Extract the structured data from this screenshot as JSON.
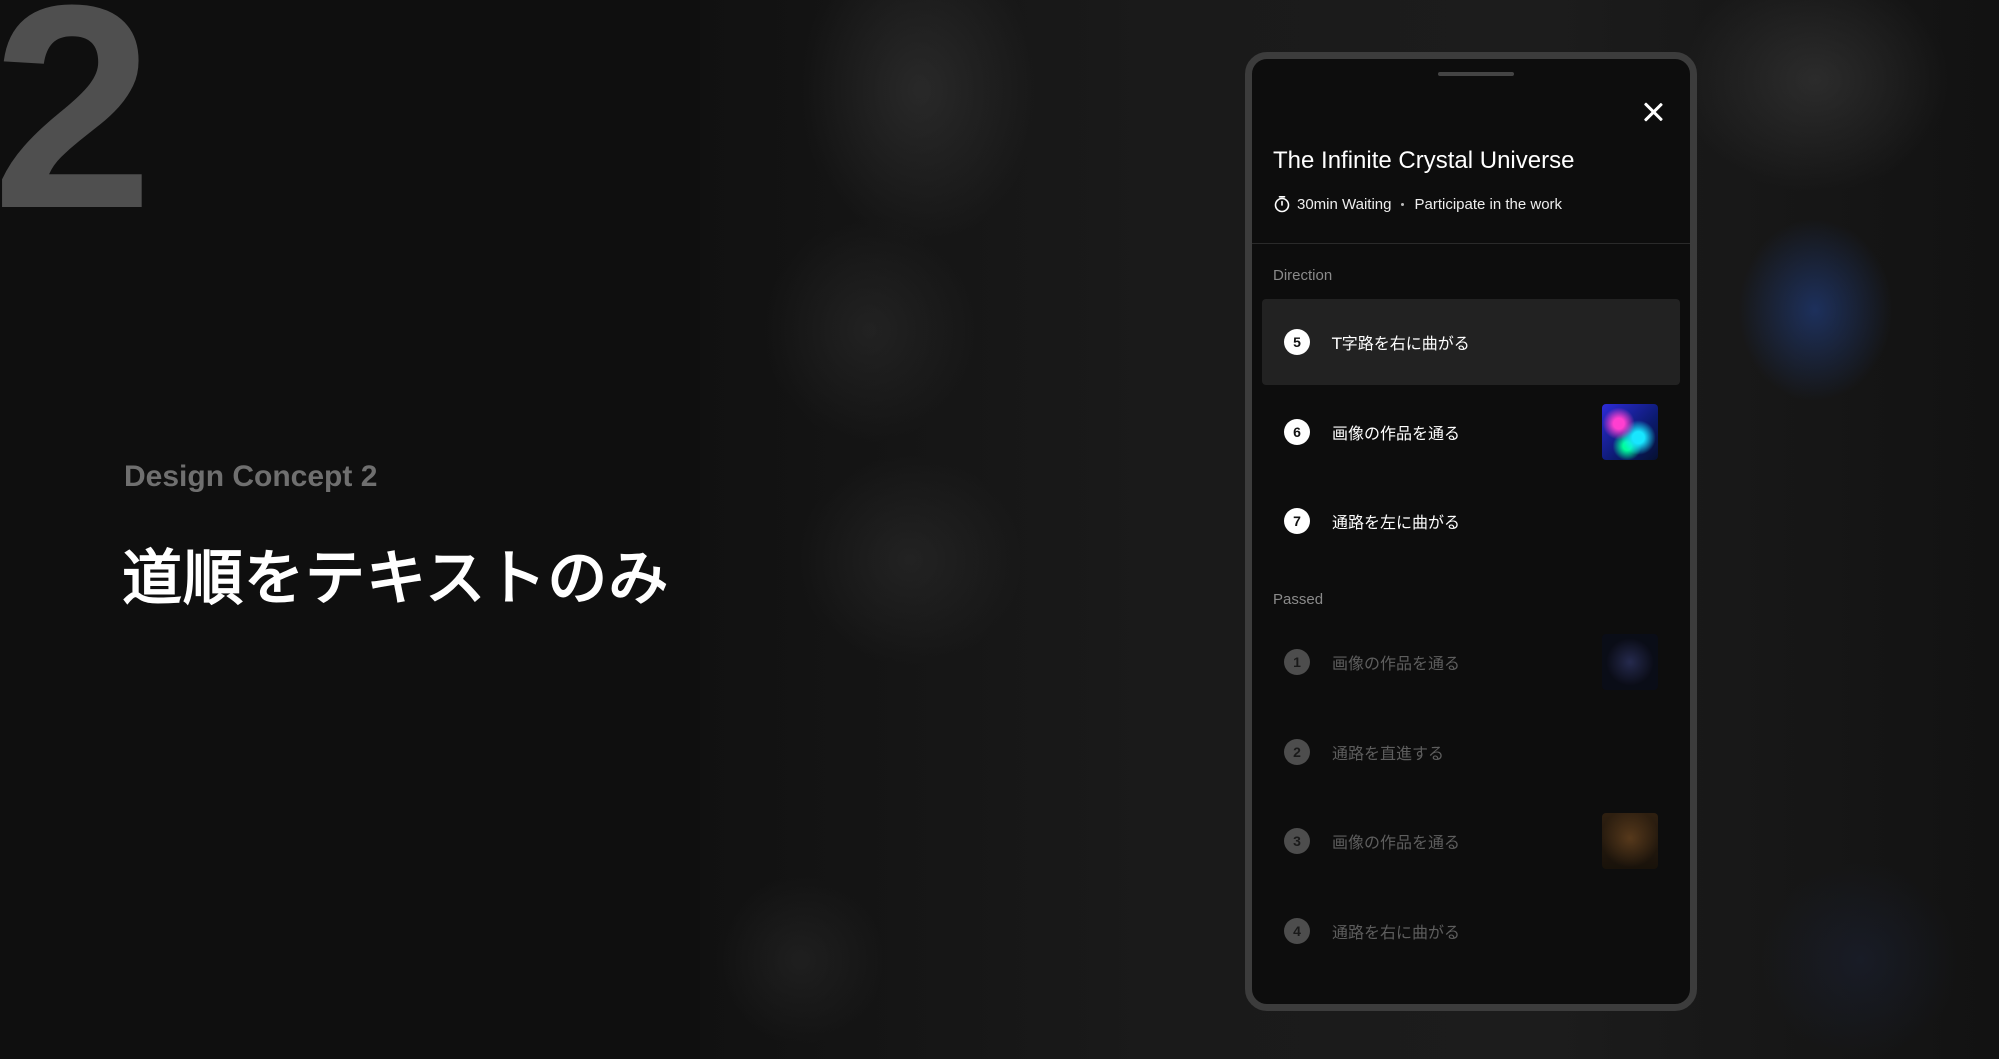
{
  "slide": {
    "number": "2",
    "concept_label": "Design Concept 2",
    "concept_title": "道順をテキストのみ"
  },
  "panel": {
    "title": "The Infinite Crystal Universe",
    "waiting": "30min Waiting",
    "participate": "Participate in the work",
    "direction_heading": "Direction",
    "passed_heading": "Passed",
    "direction_steps": [
      {
        "number": "5",
        "label": "T字路を右に曲がる",
        "state": "current",
        "thumbnail": null
      },
      {
        "number": "6",
        "label": "画像の作品を通る",
        "state": "upcoming",
        "thumbnail": "crystal-artwork"
      },
      {
        "number": "7",
        "label": "通路を左に曲がる",
        "state": "upcoming",
        "thumbnail": null
      }
    ],
    "passed_steps": [
      {
        "number": "1",
        "label": "画像の作品を通る",
        "thumbnail": "starfield-artwork"
      },
      {
        "number": "2",
        "label": "通路を直進する",
        "thumbnail": null
      },
      {
        "number": "3",
        "label": "画像の作品を通る",
        "thumbnail": "amber-artwork"
      },
      {
        "number": "4",
        "label": "通路を右に曲がる",
        "thumbnail": null
      }
    ]
  },
  "icons": {
    "close": "close-icon",
    "timer": "stopwatch-icon"
  }
}
